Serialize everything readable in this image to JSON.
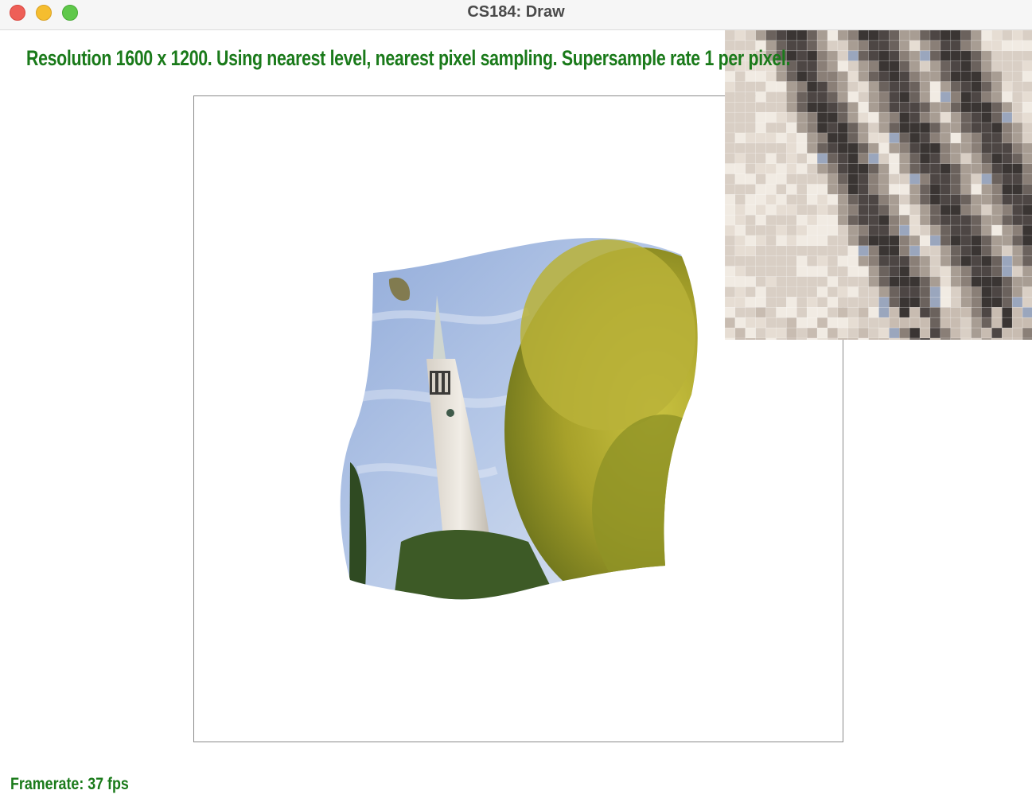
{
  "window": {
    "title": "CS184: Draw"
  },
  "hud": {
    "status_text": "Resolution 1600 x 1200. Using nearest level, nearest pixel sampling. Supersample rate 1 per pixel.",
    "framerate_text": "Framerate: 37 fps"
  },
  "icons": {
    "close": "close-traffic-light-icon",
    "minimize": "minimize-traffic-light-icon",
    "maximize": "maximize-traffic-light-icon"
  },
  "colors": {
    "hud_text": "#1a7a1a",
    "close": "#ee5f57",
    "minimize": "#f5bd2f",
    "maximize": "#5fc84a"
  }
}
